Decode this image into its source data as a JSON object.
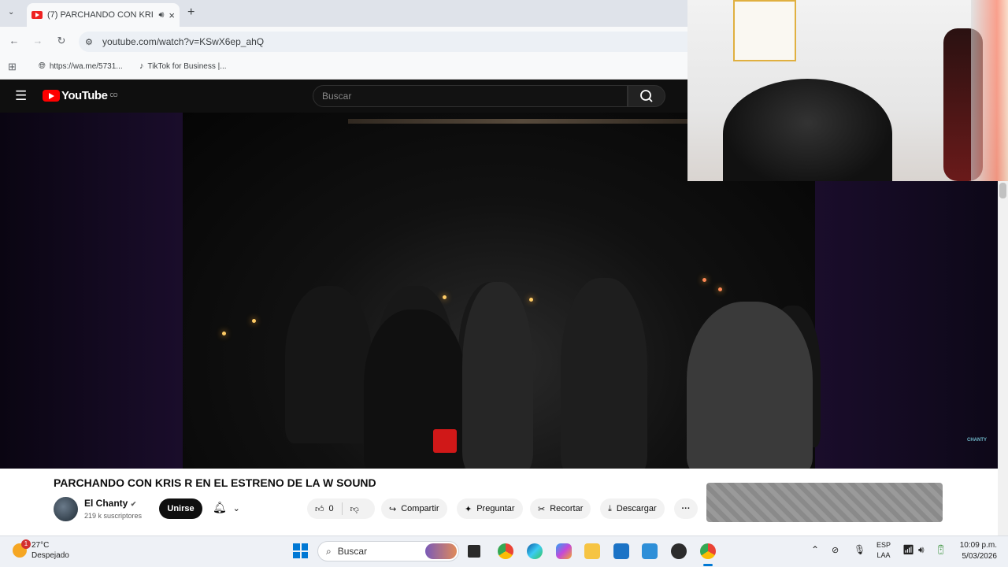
{
  "browser": {
    "tab_title": "(7) PARCHANDO CON KRIS",
    "url": "youtube.com/watch?v=KSwX6ep_ahQ",
    "bookmarks": [
      "https://wa.me/5731...",
      "TikTok for Business |..."
    ]
  },
  "youtube": {
    "logo_text": "YouTube",
    "country_code": "CO",
    "search_placeholder": "Buscar",
    "video_title": "PARCHANDO CON KRIS R EN EL ESTRENO DE LA W SOUND",
    "channel_name": "El Chanty",
    "subscribers": "219 k suscriptores",
    "join_label": "Unirse",
    "likes": "0",
    "share_label": "Compartir",
    "ask_label": "Preguntar",
    "clip_label": "Recortar",
    "download_label": "Descargar",
    "watermark": "CHANTY"
  },
  "taskbar": {
    "temperature": "27°C",
    "weather": "Despejado",
    "notification_count": "1",
    "search_label": "Buscar",
    "lang_1": "ESP",
    "lang_2": "LAA",
    "time": "10:09 p.m.",
    "date": "5/03/2026"
  },
  "colors": {
    "youtube_red": "#ff0000",
    "yt_dark": "#0f0f0f",
    "taskbar_bg": "#eef1f6"
  }
}
